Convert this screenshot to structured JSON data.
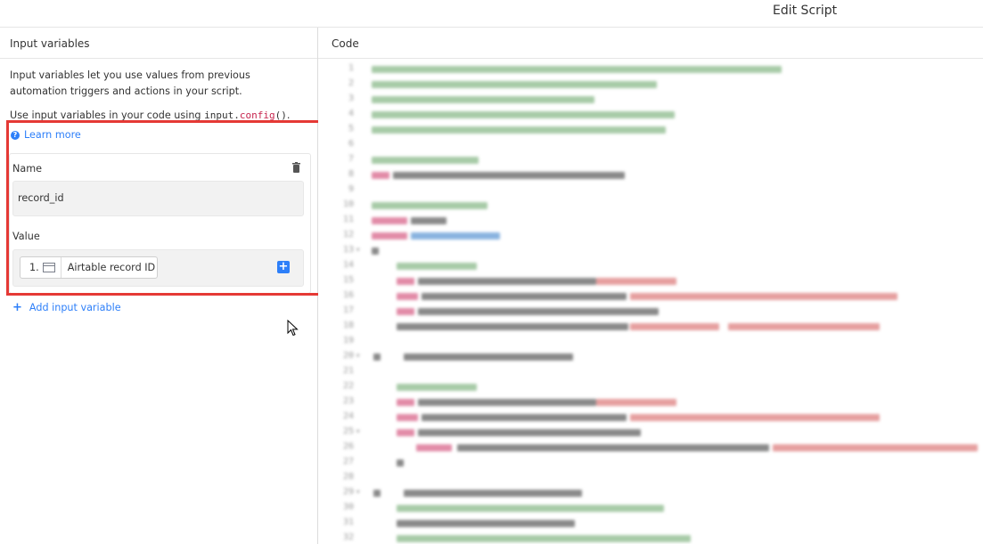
{
  "window": {
    "title": "Edit Script"
  },
  "left_panel": {
    "header": "Input variables",
    "description": "Input variables let you use values from previous automation triggers and actions in your script.",
    "usage_prefix": "Use input variables in your code using ",
    "usage_code_obj": "input.",
    "usage_code_fn": "config",
    "usage_code_suffix": "()",
    "usage_suffix": ".",
    "learn_more": "Learn more",
    "variable": {
      "name_label": "Name",
      "name_value": "record_id",
      "value_label": "Value",
      "token_index": "1.",
      "token_label": "Airtable record ID"
    },
    "add_variable": "Add input variable"
  },
  "code_panel": {
    "header": "Code",
    "line_count": 32
  },
  "colors": {
    "accent": "#2d7ff9",
    "highlight_box": "#e53935"
  }
}
